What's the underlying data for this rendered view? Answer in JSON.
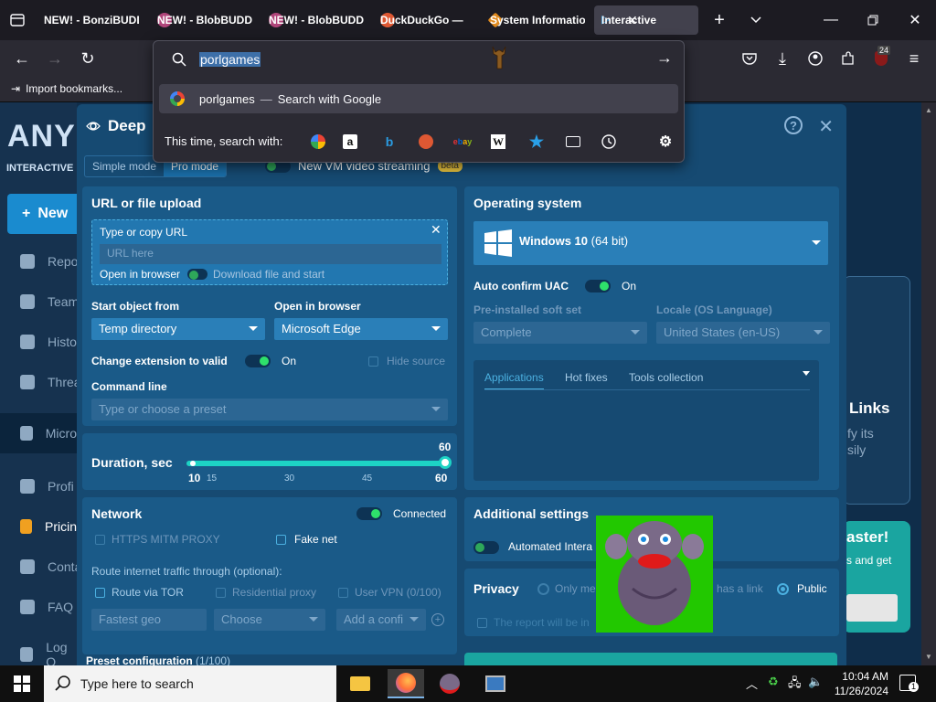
{
  "browser": {
    "tabs": [
      {
        "label": "NEW! - BonziBUDDY",
        "active": false,
        "fav_color": "#1c1b22"
      },
      {
        "label": "NEW! - BlobBUDDY",
        "active": false,
        "fav_color": "#b0457a"
      },
      {
        "label": "NEW! - BlobBUDDY",
        "active": false,
        "fav_color": "#b0457a"
      },
      {
        "label": "DuckDuckGo —",
        "active": false,
        "fav_color": "#de5833"
      },
      {
        "label": "System Information",
        "active": false,
        "fav_color": "#e08a1e"
      },
      {
        "label": "Interactive Online",
        "active": true,
        "fav_color": "#2aa0e8"
      }
    ],
    "search_query": "porlgames",
    "suggestion": {
      "text": "porlgames",
      "hint": "Search with Google"
    },
    "search_with_label": "This time, search with:",
    "bookmark_label": "Import bookmarks...",
    "badge_count": "24"
  },
  "site": {
    "logo": "ANY",
    "logo_sub": "INTERACTIVE MA",
    "new_button": "New",
    "sidebar": [
      "Repo",
      "Team",
      "Histo",
      "Threa",
      "Micro",
      "Profi",
      "Pricin",
      "Conta",
      "FAQ",
      "Log O"
    ],
    "right_card": {
      "title": "Links",
      "line1": "fy its",
      "line2": "sily"
    },
    "green_card": {
      "title": "aster!",
      "text": "s and get"
    }
  },
  "modal": {
    "title": "Deep",
    "mode_simple": "Simple mode",
    "mode_pro": "Pro mode",
    "vm_streaming": "New VM video streaming",
    "beta": "beta",
    "url_section": {
      "title": "URL or file upload",
      "box_label": "Type or copy URL",
      "url_placeholder": "URL here",
      "open_in_browser": "Open in browser",
      "download_file": "Download file and start"
    },
    "start_object": {
      "label": "Start object from",
      "value": "Temp directory"
    },
    "open_browser": {
      "label": "Open in browser",
      "value": "Microsoft Edge"
    },
    "change_extension": {
      "label": "Change extension to valid",
      "state": "On"
    },
    "hide_source": "Hide source",
    "command_line": {
      "label": "Command line",
      "placeholder": "Type or choose a preset"
    },
    "duration": {
      "label": "Duration, sec",
      "value": "60",
      "ticks": [
        "10",
        "15",
        "30",
        "45",
        "60"
      ]
    },
    "os": {
      "title": "Operating system",
      "name": "Windows 10",
      "arch": "(64 bit)",
      "uac_label": "Auto confirm UAC",
      "uac_state": "On",
      "preinstalled_label": "Pre-installed soft set",
      "preinstalled_value": "Complete",
      "locale_label": "Locale (OS Language)",
      "locale_value": "United States (en-US)",
      "tabs": [
        "Applications",
        "Hot fixes",
        "Tools collection"
      ]
    },
    "network": {
      "title": "Network",
      "status": "Connected",
      "https_mitm": "HTTPS MITM PROXY",
      "fake_net": "Fake net",
      "route_label": "Route internet traffic through (optional):",
      "route_tor": "Route via TOR",
      "residential": "Residential proxy",
      "user_vpn": "User VPN (0/100)",
      "geo_placeholder": "Fastest geo",
      "choose_placeholder": "Choose",
      "config_placeholder": "Add a confi"
    },
    "additional": {
      "title": "Additional settings",
      "automated": "Automated Intera"
    },
    "privacy": {
      "title": "Privacy",
      "only_me": "Only me",
      "has_link": "has a link",
      "public": "Public",
      "report_note": "The report will be in"
    },
    "preset": {
      "label": "Preset configuration",
      "count": "(1/100)"
    }
  },
  "taskbar": {
    "search_placeholder": "Type here to search",
    "time": "10:04 AM",
    "date": "11/26/2024",
    "notif_count": "1"
  }
}
